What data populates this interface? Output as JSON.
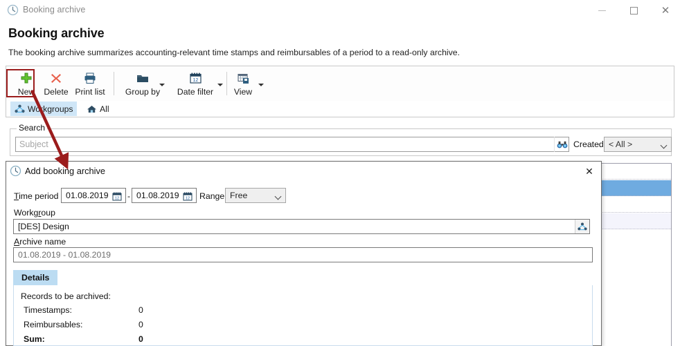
{
  "window": {
    "title": "Booking archive",
    "icon": "clock-icon",
    "minimize_label": "–",
    "maximize_label": "□",
    "close_label": "✕"
  },
  "page": {
    "heading": "Booking archive",
    "description": "The booking archive summarizes accounting-relevant time stamps and reimbursables of a period to a read-only archive."
  },
  "toolbar": {
    "items": [
      {
        "label": "New",
        "icon": "plus-icon"
      },
      {
        "label": "Delete",
        "icon": "cross-icon"
      },
      {
        "label": "Print list",
        "icon": "printer-icon"
      },
      {
        "label": "Group by",
        "icon": "folder-icon"
      },
      {
        "label": "Date filter",
        "icon": "calendar-icon"
      },
      {
        "label": "View",
        "icon": "grid-save-icon"
      }
    ]
  },
  "scope_tabs": [
    {
      "label": "Workgroups",
      "icon": "workgroup-icon",
      "active": true
    },
    {
      "label": "All",
      "icon": "home-icon",
      "active": false
    }
  ],
  "search": {
    "legend": "Search",
    "placeholder": "Subject",
    "value": "",
    "search_icon": "binoculars-icon",
    "created_label": "Created",
    "created_value": "< All >"
  },
  "dialog": {
    "icon": "clock-icon",
    "title": "Add booking archive",
    "close_label": "✕",
    "time_period_label": "Time period",
    "date_from": "01.08.2019",
    "date_to": "01.08.2019",
    "date_separator": "-",
    "date_picker_icon": "calendar-icon",
    "range_label": "Range",
    "range_value": "Free",
    "workgroup_label": "Workgroup",
    "workgroup_value": "[DES] Design",
    "workgroup_picker_icon": "workgroup-icon",
    "archive_name_label": "Archive name",
    "archive_name_value": "01.08.2019 - 01.08.2019",
    "tab_label": "Details",
    "details": {
      "heading": "Records to be archived:",
      "rows": [
        {
          "label": "Timestamps:",
          "value": "0"
        },
        {
          "label": "Reimbursables:",
          "value": "0"
        },
        {
          "label": "Sum:",
          "value": "0"
        }
      ]
    }
  },
  "colors": {
    "accent_blue": "#6fabe0",
    "tab_blue": "#bcdcf2",
    "annotation_red": "#9b1c1c",
    "new_green": "#5cb531",
    "delete_red": "#e05c4a"
  }
}
